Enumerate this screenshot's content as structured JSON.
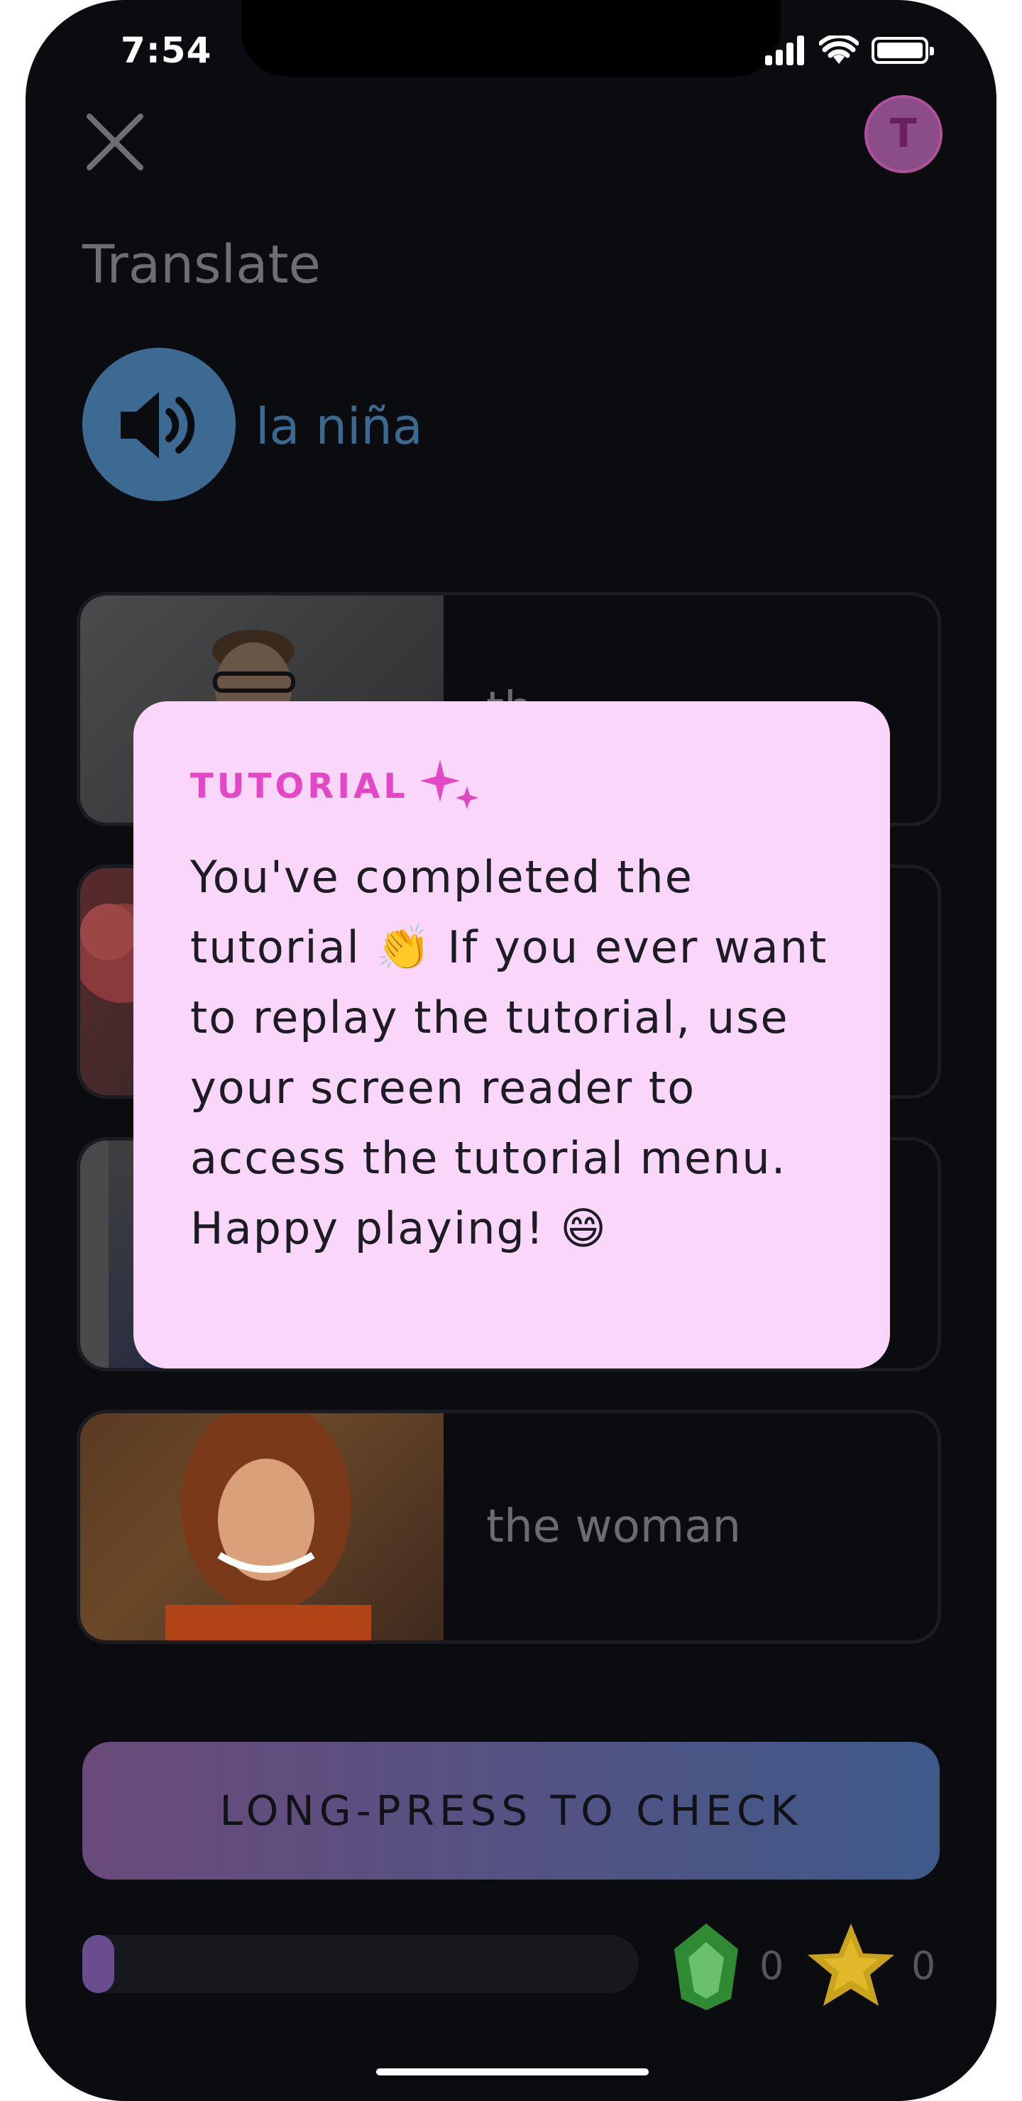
{
  "status_bar": {
    "time": "7:54"
  },
  "header": {
    "avatar_initial": "T",
    "title": "Translate"
  },
  "prompt": {
    "word": "la niña"
  },
  "options": [
    {
      "label": "th"
    },
    {
      "label": ""
    },
    {
      "label": ""
    },
    {
      "label": "the woman"
    }
  ],
  "tutorial": {
    "tag": "TUTORIAL",
    "message": "You've completed the tutorial 👏 If you ever want to replay the tutorial, use your screen reader to access the tutorial menu. Happy playing! 😄"
  },
  "check_button": {
    "label": "LONG-PRESS TO CHECK"
  },
  "footer": {
    "progress": 0.03,
    "gems": "0",
    "stars": "0"
  },
  "colors": {
    "background": "#0b0c10",
    "tutorial_bg": "#fbd6fb",
    "tutorial_accent": "#e347c5",
    "prompt_blue": "#3d6a93"
  }
}
